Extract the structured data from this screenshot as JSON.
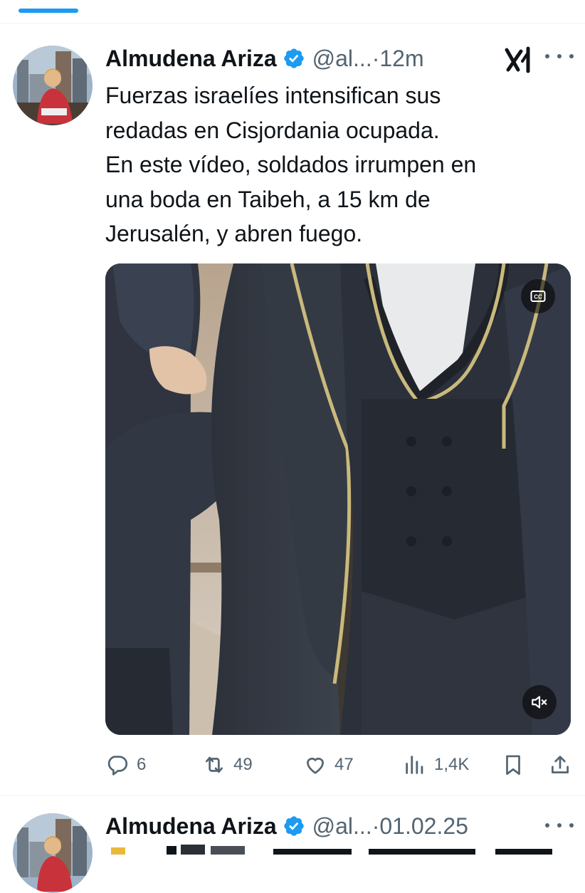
{
  "tweets": [
    {
      "author_name": "Almudena Ariza",
      "handle": "@al...",
      "time": "·12m",
      "text": "Fuerzas israelíes intensifican sus\nredadas en Cisjordania ocupada.\nEn este vídeo, soldados irrumpen en\nuna boda en Taibeh, a 15 km de\nJerusalén, y abren fuego.",
      "stats": {
        "replies": "6",
        "retweets": "49",
        "likes": "47",
        "views": "1,4K"
      }
    },
    {
      "author_name": "Almudena Ariza",
      "handle": "@al...",
      "time": "·01.02.25"
    }
  ],
  "icons": {
    "verified": "verified-badge-icon",
    "grok": "grok-icon",
    "more": "more-icon",
    "cc": "closed-captions-icon",
    "mute": "muted-speaker-icon",
    "reply": "reply-icon",
    "retweet": "retweet-icon",
    "like": "heart-icon",
    "views": "views-icon",
    "bookmark": "bookmark-icon",
    "share": "share-icon"
  },
  "colors": {
    "accent": "#1d9bf0",
    "text": "#0f1419",
    "secondary": "#536471",
    "divider": "#eff3f4"
  }
}
